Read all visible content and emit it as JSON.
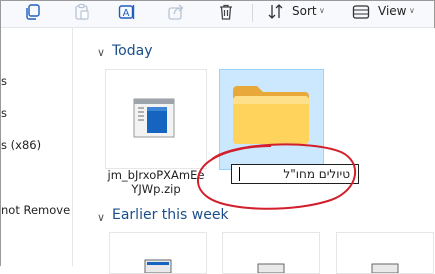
{
  "toolbar": {
    "icons": [
      "copy-icon",
      "paste-icon",
      "rename-icon",
      "share-icon",
      "delete-icon"
    ],
    "sort_label": "Sort",
    "view_label": "View"
  },
  "nav": {
    "items": [
      {
        "label": "s"
      },
      {
        "label": "s"
      },
      {
        "label": "s (x86)"
      },
      {
        "label": "not Remove"
      }
    ]
  },
  "groups": [
    {
      "label": "Today"
    },
    {
      "label": "Earlier this week"
    }
  ],
  "files": [
    {
      "name_line1": "jm_bJrxoPXAmEe",
      "name_line2": "YJWp.zip",
      "icon": "zip-file-icon"
    },
    {
      "rename_value": "טיולים מחו\"ל",
      "icon": "folder-icon",
      "selected": true
    }
  ],
  "colors": {
    "selection": "#cce8ff",
    "annotation": "#d21f2b",
    "group_text": "#1a4e8a"
  }
}
